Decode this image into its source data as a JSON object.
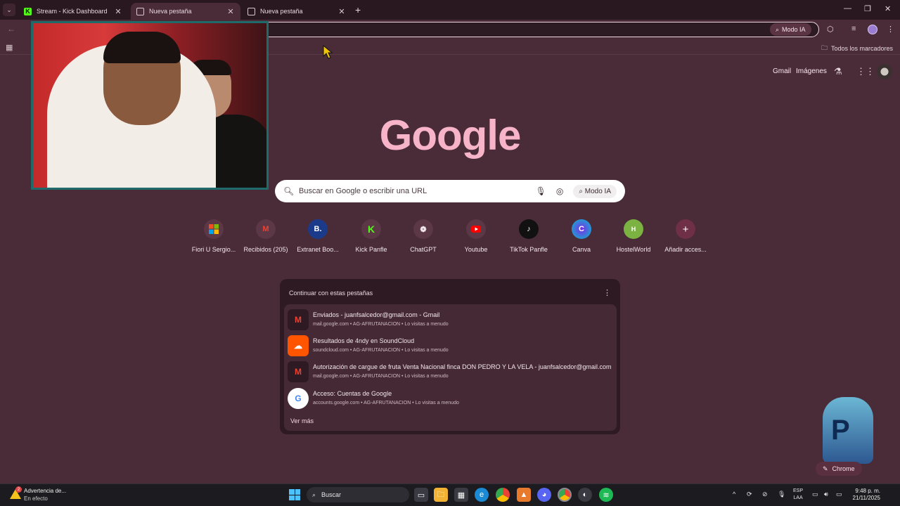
{
  "tabs": [
    {
      "label": "Stream - Kick Dashboard",
      "active": false
    },
    {
      "label": "Nueva pestaña",
      "active": true
    },
    {
      "label": "Nueva pestaña",
      "active": false
    }
  ],
  "toolbar": {
    "modo_ia": "Modo IA",
    "all_bookmarks": "Todos los marcadores"
  },
  "header": {
    "gmail": "Gmail",
    "images": "Imágenes"
  },
  "logo": "Google",
  "search": {
    "placeholder": "Buscar en Google o escribir una URL",
    "ai_label": "Modo IA"
  },
  "shortcuts": [
    {
      "label": "Fiori U Sergio...",
      "icon": "windows-icon"
    },
    {
      "label": "Recibidos (205)",
      "icon": "gmail-icon"
    },
    {
      "label": "Extranet Boo...",
      "icon": "booking-icon"
    },
    {
      "label": "Kick Panfle",
      "icon": "kick-icon"
    },
    {
      "label": "ChatGPT",
      "icon": "chatgpt-icon"
    },
    {
      "label": "Youtube",
      "icon": "youtube-icon"
    },
    {
      "label": "TikTok Panfle",
      "icon": "tiktok-icon"
    },
    {
      "label": "Canva",
      "icon": "canva-icon"
    },
    {
      "label": "HostelWorld",
      "icon": "hostelworld-icon"
    },
    {
      "label": "Añadir acces...",
      "icon": "plus-icon"
    }
  ],
  "continue_card": {
    "title": "Continuar con estas pestañas",
    "items": [
      {
        "title": "Enviados - juanfsalcedor@gmail.com - Gmail",
        "meta": "mail.google.com • AG-AFRUTANACION • Lo visitas a menudo",
        "icon": "gmail-icon"
      },
      {
        "title": "Resultados de 4ndy en SoundCloud",
        "meta": "soundcloud.com • AG-AFRUTANACION • Lo visitas a menudo",
        "icon": "soundcloud-icon"
      },
      {
        "title": "Autorización de cargue de fruta Venta Nacional finca DON PEDRO Y LA VELA - juanfsalcedor@gmail.com - G...",
        "meta": "mail.google.com • AG-AFRUTANACION • Lo visitas a menudo",
        "icon": "gmail-icon"
      },
      {
        "title": "Acceso: Cuentas de Google",
        "meta": "accounts.google.com • AG-AFRUTANACION • Lo visitas a menudo",
        "icon": "google-icon"
      }
    ],
    "more": "Ver más"
  },
  "chrome_button": "Chrome",
  "taskbar": {
    "warning_title": "Advertencia de...",
    "warning_sub": "En efecto",
    "warning_count": "2",
    "search": "Buscar",
    "lang_1": "ESP",
    "lang_2": "LAA",
    "time": "9:48 p. m.",
    "date": "21/11/2025"
  },
  "colors": {
    "background": "#4a2c38",
    "logo": "#f7b4c9",
    "card": "#2d1a22"
  }
}
